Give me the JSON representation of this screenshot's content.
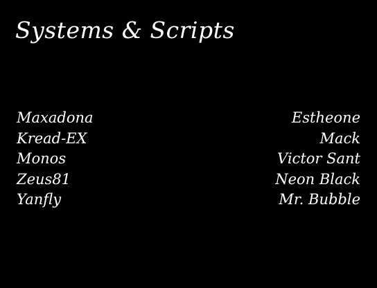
{
  "credits": {
    "title": "Systems & Scripts",
    "left_names": [
      "Maxadona",
      "Kread-EX",
      "Monos",
      "Zeus81",
      "Yanfly"
    ],
    "right_names": [
      "Estheone",
      "Mack",
      "Victor Sant",
      "Neon Black",
      "Mr. Bubble"
    ]
  },
  "colors": {
    "background": "#000000",
    "text": "#ffffff"
  }
}
